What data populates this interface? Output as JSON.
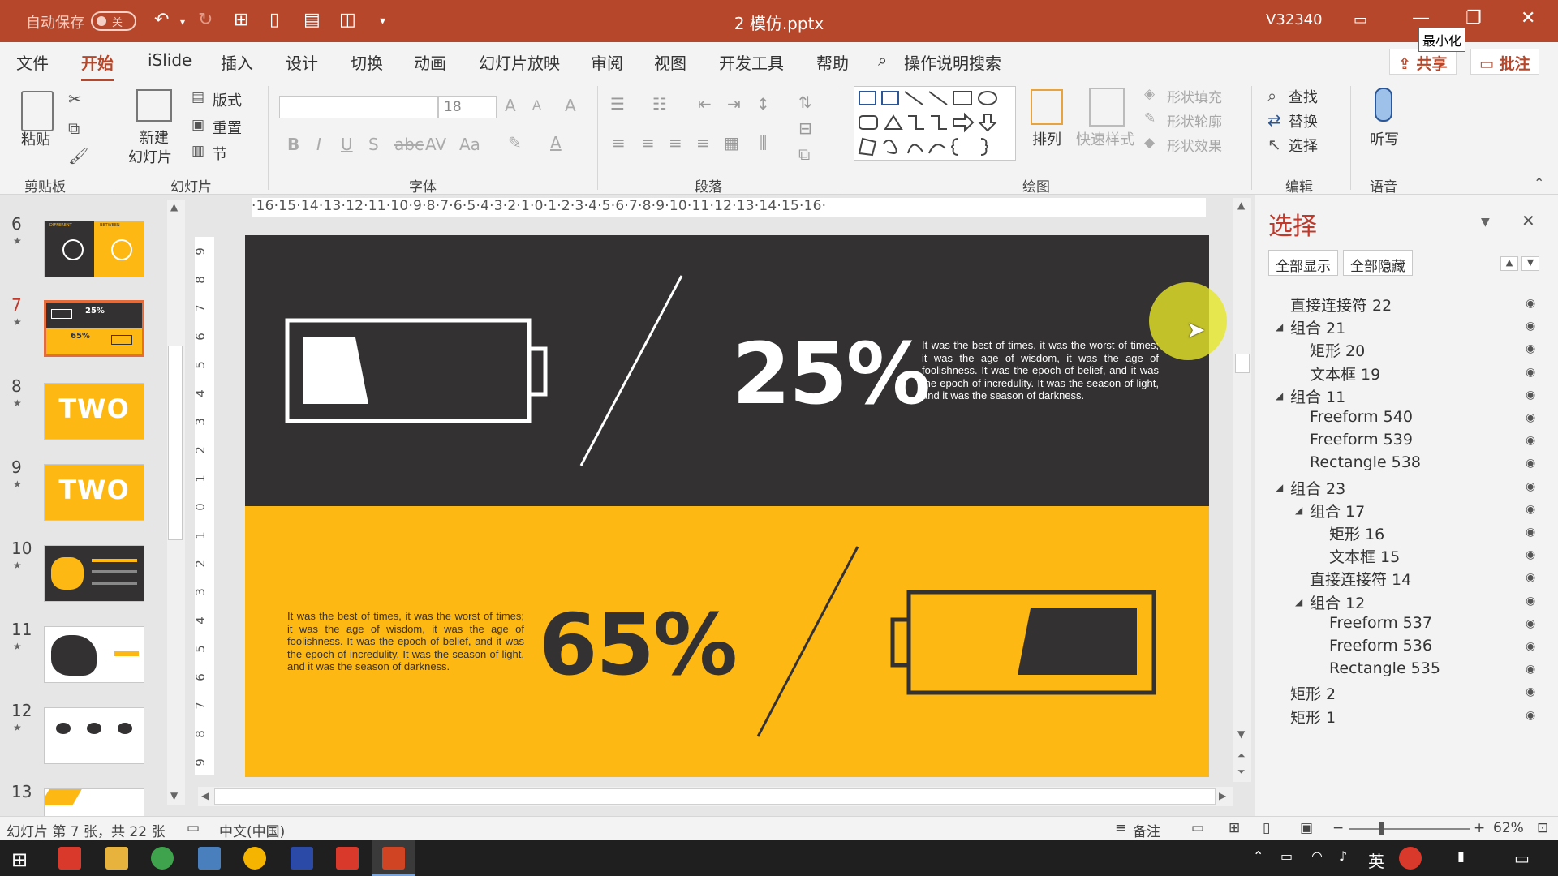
{
  "titlebar": {
    "autosave_label": "自动保存",
    "autosave_state": "关",
    "document_title": "2 模仿.pptx",
    "user_name": "V32340",
    "minimize_tooltip": "最小化"
  },
  "ribbon_tabs": [
    "文件",
    "开始",
    "iSlide",
    "插入",
    "设计",
    "切换",
    "动画",
    "幻灯片放映",
    "审阅",
    "视图",
    "开发工具",
    "帮助"
  ],
  "active_tab": "开始",
  "search_label": "操作说明搜索",
  "share_label": "共享",
  "comment_label": "批注",
  "ribbon": {
    "clipboard": {
      "label": "剪贴板",
      "paste": "粘贴"
    },
    "slides": {
      "label": "幻灯片",
      "new_slide_line1": "新建",
      "new_slide_line2": "幻灯片",
      "layout": "版式",
      "reset": "重置",
      "section": "节"
    },
    "font": {
      "label": "字体",
      "font_size": "18"
    },
    "paragraph": {
      "label": "段落"
    },
    "drawing": {
      "label": "绘图",
      "arrange": "排列",
      "quick_styles": "快速样式",
      "shape_fill": "形状填充",
      "shape_outline": "形状轮廓",
      "shape_effects": "形状效果"
    },
    "editing": {
      "label": "编辑",
      "find": "查找",
      "replace": "替换",
      "select": "选择"
    },
    "voice": {
      "label": "语音",
      "dictate": "听写"
    }
  },
  "ruler": {
    "horizontal": "·16·15·14·13·12·11·10·9·8·7·6·5·4·3·2·1·0·1·2·3·4·5·6·7·8·9·10·11·12·13·14·15·16·",
    "vertical": [
      "9",
      "8",
      "7",
      "6",
      "5",
      "4",
      "3",
      "2",
      "1",
      "0",
      "1",
      "2",
      "3",
      "4",
      "5",
      "6",
      "7",
      "8",
      "9"
    ]
  },
  "thumbnails": [
    {
      "num": "6",
      "style": "dark-yellow"
    },
    {
      "num": "7",
      "style": "battery",
      "active": true
    },
    {
      "num": "8",
      "style": "two"
    },
    {
      "num": "9",
      "style": "two"
    },
    {
      "num": "10",
      "style": "dark-map"
    },
    {
      "num": "11",
      "style": "china-map"
    },
    {
      "num": "12",
      "style": "icons"
    },
    {
      "num": "13",
      "style": "partial"
    }
  ],
  "thumb_text": {
    "t6_left": "DIFFERENT",
    "t6_right": "BETWEEN",
    "t7_top_pct": "25%",
    "t7_bottom_pct": "65%",
    "t8": "TWO",
    "t9": "TWO"
  },
  "slide": {
    "top_percent": "25%",
    "bottom_percent": "65%",
    "top_paragraph": "It was the best of times, it was the worst of times; it was the age of wisdom, it was the age of foolishness. It was the epoch of belief, and it was the epoch of incredulity. It was the season of light, and it was the season of darkness.",
    "bottom_paragraph": "It was the best of times, it was the worst of times; it was the age of wisdom, it was the age of foolishness. It was the epoch of belief, and it was the epoch of incredulity. It was the season of light, and it was the season of darkness.",
    "top_battery_level": 0.25,
    "bottom_battery_level": 0.65,
    "colors": {
      "dark": "#333132",
      "yellow": "#FDB813",
      "white": "#FFFFFF"
    }
  },
  "selection_pane": {
    "title": "选择",
    "show_all": "全部显示",
    "hide_all": "全部隐藏",
    "items": [
      {
        "label": "直接连接符 22",
        "level": 0,
        "expander": false
      },
      {
        "label": "组合 21",
        "level": 0,
        "expander": true
      },
      {
        "label": "矩形 20",
        "level": 1,
        "expander": false
      },
      {
        "label": "文本框 19",
        "level": 1,
        "expander": false
      },
      {
        "label": "组合 11",
        "level": 0,
        "expander": true
      },
      {
        "label": "Freeform 540",
        "level": 1,
        "expander": false
      },
      {
        "label": "Freeform 539",
        "level": 1,
        "expander": false
      },
      {
        "label": "Rectangle 538",
        "level": 1,
        "expander": false
      },
      {
        "label": "组合 23",
        "level": 0,
        "expander": true
      },
      {
        "label": "组合 17",
        "level": 1,
        "expander": true
      },
      {
        "label": "矩形 16",
        "level": 2,
        "expander": false
      },
      {
        "label": "文本框 15",
        "level": 2,
        "expander": false
      },
      {
        "label": "直接连接符 14",
        "level": 1,
        "expander": false
      },
      {
        "label": "组合 12",
        "level": 1,
        "expander": true
      },
      {
        "label": "Freeform 537",
        "level": 2,
        "expander": false
      },
      {
        "label": "Freeform 536",
        "level": 2,
        "expander": false
      },
      {
        "label": "Rectangle 535",
        "level": 2,
        "expander": false
      },
      {
        "label": "矩形 2",
        "level": 0,
        "expander": false
      },
      {
        "label": "矩形 1",
        "level": 0,
        "expander": false
      }
    ]
  },
  "statusbar": {
    "slide_info": "幻灯片 第 7 张，共 22 张",
    "language": "中文(中国)",
    "notes": "备注",
    "zoom": "62%"
  },
  "taskbar": {
    "ime": "英"
  }
}
